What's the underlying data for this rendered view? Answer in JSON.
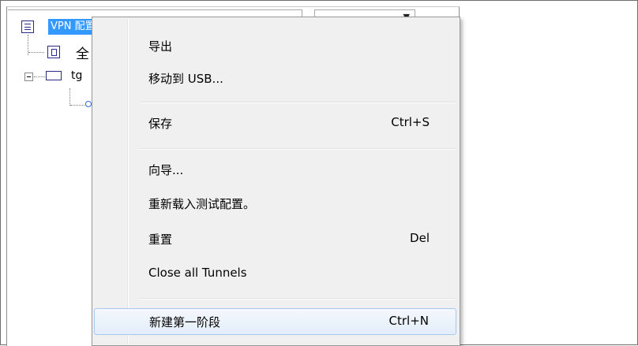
{
  "tree": {
    "root_label": "VPN 配置",
    "child1_label": "全",
    "child2_label": "tg"
  },
  "combo": {
    "arrow_icon": "dropdown-arrow-icon"
  },
  "menu": {
    "items": [
      {
        "label": "导出",
        "shortcut": ""
      },
      {
        "label": "移动到 USB...",
        "shortcut": ""
      },
      {
        "label": "保存",
        "shortcut": "Ctrl+S"
      },
      {
        "label": "向导...",
        "shortcut": ""
      },
      {
        "label": "重新载入测试配置。",
        "shortcut": ""
      },
      {
        "label": "重置",
        "shortcut": "Del"
      },
      {
        "label": "Close all Tunnels",
        "shortcut": ""
      },
      {
        "label": "新建第一阶段",
        "shortcut": "Ctrl+N"
      }
    ],
    "highlighted_index": 7
  },
  "colors": {
    "selection": "#3399ff",
    "menu_bg": "#f0f0f0",
    "hover_border": "#a8c8ec"
  }
}
